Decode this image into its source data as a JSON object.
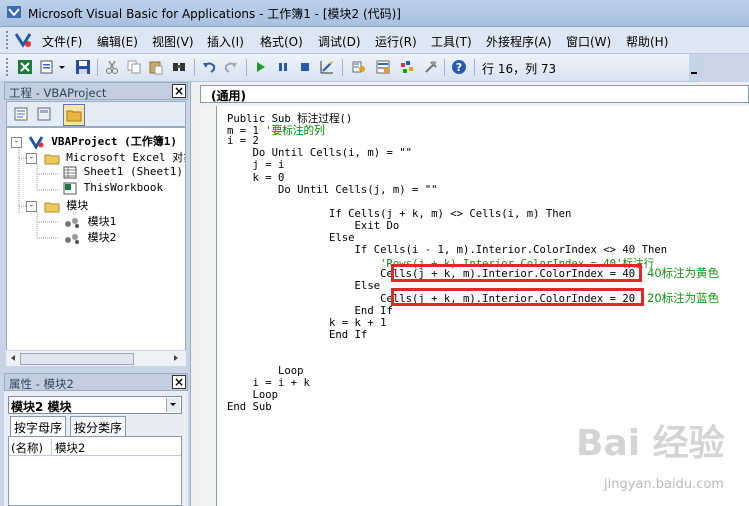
{
  "window": {
    "title": "Microsoft Visual Basic for Applications - 工作簿1 - [模块2 (代码)]"
  },
  "menu": {
    "items": [
      "文件(F)",
      "编辑(E)",
      "视图(V)",
      "插入(I)",
      "格式(O)",
      "调试(D)",
      "运行(R)",
      "工具(T)",
      "外接程序(A)",
      "窗口(W)",
      "帮助(H)"
    ]
  },
  "toolbar": {
    "position": "行 16，列 73",
    "icons": [
      "excel-icon",
      "insert-module-icon",
      "save-icon",
      "cut-icon",
      "copy-icon",
      "paste-icon",
      "find-icon",
      "undo-icon",
      "redo-icon",
      "run-icon",
      "break-icon",
      "reset-icon",
      "design-mode-icon",
      "project-explorer-icon",
      "properties-icon",
      "object-browser-icon",
      "toolbox-icon",
      "help-icon"
    ]
  },
  "project_panel": {
    "title": "工程 - VBAProject",
    "tree": [
      {
        "label": "VBAProject (工作簿1)",
        "level": 0,
        "bold": true
      },
      {
        "label": "Microsoft Excel 对象",
        "level": 1,
        "bold": false
      },
      {
        "label": "Sheet1 (Sheet1)",
        "level": 2,
        "bold": false
      },
      {
        "label": "ThisWorkbook",
        "level": 2,
        "bold": false
      },
      {
        "label": "模块",
        "level": 1,
        "bold": false
      },
      {
        "label": "模块1",
        "level": 2,
        "bold": false
      },
      {
        "label": "模块2",
        "level": 2,
        "bold": false
      }
    ]
  },
  "properties_panel": {
    "title": "属性 - 模块2",
    "object_selector": "模块2 模块",
    "tabs": [
      "按字母序",
      "按分类序"
    ],
    "rows": [
      {
        "name": "(名称)",
        "value": "模块2"
      }
    ]
  },
  "code_window": {
    "object_selector": "(通用)",
    "lines": [
      "Public Sub 标注过程()",
      "m = 1 '要标注的列",
      "i = 2",
      "    Do Until Cells(i, m) = \"\"",
      "    j = i",
      "    k = 0",
      "        Do Until Cells(j, m) = \"\"",
      "",
      "                If Cells(j + k, m) <> Cells(i, m) Then",
      "                    Exit Do",
      "                Else",
      "                    If Cells(i - 1, m).Interior.ColorIndex <> 40 Then",
      "                        'Rows(j + k).Interior.ColorIndex = 40'标注行",
      "                        Cells(j + k, m).Interior.ColorIndex = 40",
      "                    Else",
      "                        Cells(j + k, m).Interior.ColorIndex = 20",
      "                    End If",
      "                k = k + 1",
      "                End If",
      "",
      "",
      "        Loop",
      "    i = i + k",
      "    Loop",
      "End Sub"
    ],
    "annotations": [
      "40标注为黄色",
      "20标注为蓝色"
    ]
  },
  "watermark": {
    "text": "Bai 经验",
    "sub": "jingyan.baidu.com"
  }
}
